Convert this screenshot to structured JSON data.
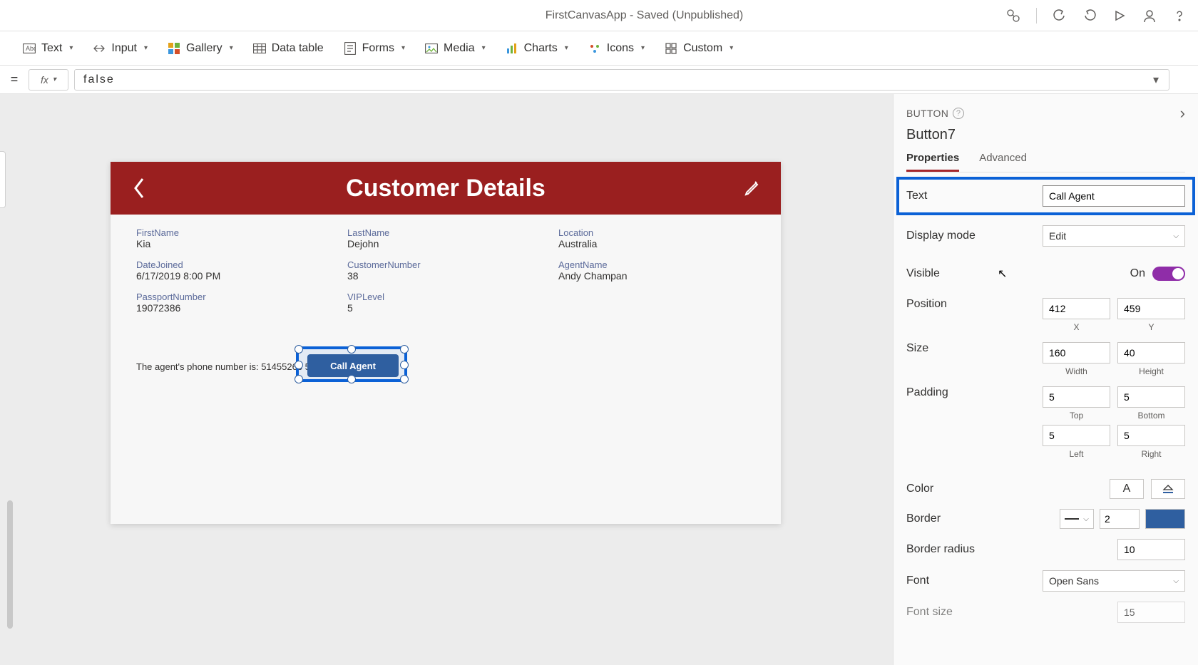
{
  "titlebar": {
    "title": "FirstCanvasApp - Saved (Unpublished)"
  },
  "ribbon": {
    "text": "Text",
    "input": "Input",
    "gallery": "Gallery",
    "dataTable": "Data table",
    "forms": "Forms",
    "media": "Media",
    "charts": "Charts",
    "icons": "Icons",
    "custom": "Custom"
  },
  "formula": {
    "value": "false"
  },
  "screen": {
    "title": "Customer Details",
    "fields": {
      "firstName": {
        "label": "FirstName",
        "value": "Kia"
      },
      "lastName": {
        "label": "LastName",
        "value": "Dejohn"
      },
      "location": {
        "label": "Location",
        "value": "Australia"
      },
      "dateJoined": {
        "label": "DateJoined",
        "value": "6/17/2019 8:00 PM"
      },
      "customerNumber": {
        "label": "CustomerNumber",
        "value": "38"
      },
      "agentName": {
        "label": "AgentName",
        "value": "Andy Champan"
      },
      "passportNumber": {
        "label": "PassportNumber",
        "value": "19072386"
      },
      "vipLevel": {
        "label": "VIPLevel",
        "value": "5"
      }
    },
    "phoneText": "The agent's phone number is:  51455266 5",
    "buttonLabel": "Call Agent"
  },
  "props": {
    "type": "BUTTON",
    "name": "Button7",
    "tabs": {
      "properties": "Properties",
      "advanced": "Advanced"
    },
    "text": {
      "label": "Text",
      "value": "Call Agent"
    },
    "displayMode": {
      "label": "Display mode",
      "value": "Edit"
    },
    "visible": {
      "label": "Visible",
      "state": "On"
    },
    "position": {
      "label": "Position",
      "x": "412",
      "y": "459",
      "xLabel": "X",
      "yLabel": "Y"
    },
    "size": {
      "label": "Size",
      "w": "160",
      "h": "40",
      "wLabel": "Width",
      "hLabel": "Height"
    },
    "padding": {
      "label": "Padding",
      "top": "5",
      "bottom": "5",
      "left": "5",
      "right": "5",
      "topLabel": "Top",
      "bottomLabel": "Bottom",
      "leftLabel": "Left",
      "rightLabel": "Right"
    },
    "color": {
      "label": "Color",
      "charGlyph": "A"
    },
    "border": {
      "label": "Border",
      "width": "2"
    },
    "borderRadius": {
      "label": "Border radius",
      "value": "10"
    },
    "font": {
      "label": "Font",
      "value": "Open Sans"
    },
    "fontSize": {
      "label": "Font size",
      "value": "15"
    }
  }
}
